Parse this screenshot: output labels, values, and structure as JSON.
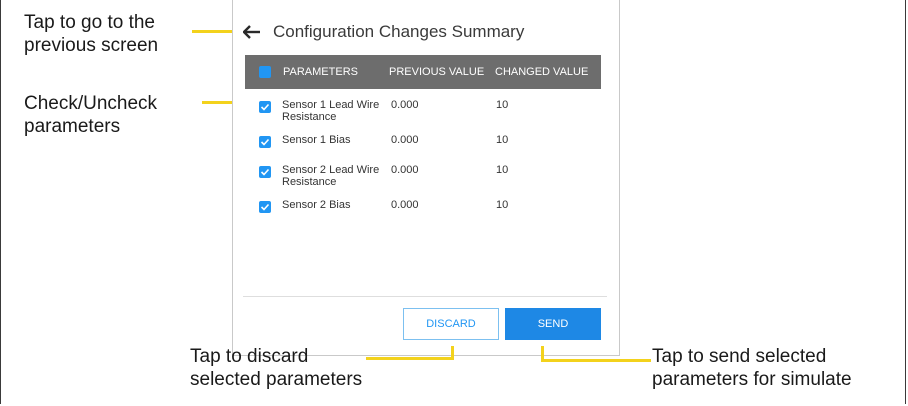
{
  "screen": {
    "title": "Configuration Changes Summary",
    "back_icon": "arrow-left-icon",
    "columns": {
      "parameters": "PARAMETERS",
      "previous_value": "PREVIOUS VALUE",
      "changed_value": "CHANGED VALUE"
    },
    "rows": [
      {
        "parameter": "Sensor 1 Lead Wire Resistance",
        "previous": "0.000",
        "changed": "10",
        "checked": true
      },
      {
        "parameter": "Sensor 1 Bias",
        "previous": "0.000",
        "changed": "10",
        "checked": true
      },
      {
        "parameter": "Sensor 2 Lead Wire Resistance",
        "previous": "0.000",
        "changed": "10",
        "checked": true
      },
      {
        "parameter": "Sensor 2 Bias",
        "previous": "0.000",
        "changed": "10",
        "checked": true
      }
    ],
    "discard_label": "DISCARD",
    "send_label": "SEND",
    "accent_color": "#1e88e5"
  },
  "annotations": {
    "back": [
      "Tap to go to the",
      "previous screen"
    ],
    "check": [
      "Check/Uncheck",
      "parameters"
    ],
    "discard": [
      "Tap to discard",
      "selected parameters"
    ],
    "send": [
      "Tap to send selected",
      "parameters for simulate"
    ],
    "leader_color": "#f3d21c"
  }
}
